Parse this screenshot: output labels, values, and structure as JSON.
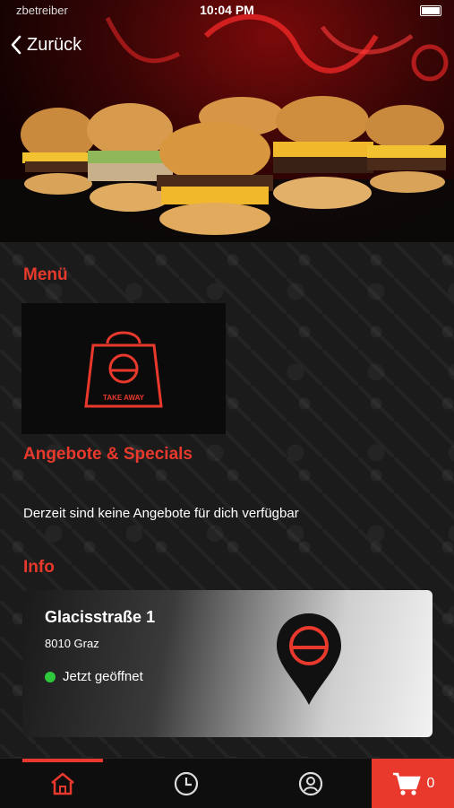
{
  "status": {
    "carrier": "zbetreiber",
    "time": "10:04 PM"
  },
  "nav": {
    "back_label": "Zurück"
  },
  "sections": {
    "menu": "Menü",
    "offers": "Angebote & Specials",
    "info": "Info"
  },
  "menu_card": {
    "badge_text": "TAKE AWAY"
  },
  "offers": {
    "empty_text": "Derzeit sind keine Angebote für dich verfügbar"
  },
  "location": {
    "street": "Glacisstraße 1",
    "city": "8010 Graz",
    "status": "Jetzt geöffnet"
  },
  "colors": {
    "accent": "#e8392c",
    "open": "#2fc83c"
  },
  "tabbar": {
    "tabs": [
      "home-icon",
      "clock-icon",
      "user-icon"
    ],
    "cart_count": "0"
  }
}
